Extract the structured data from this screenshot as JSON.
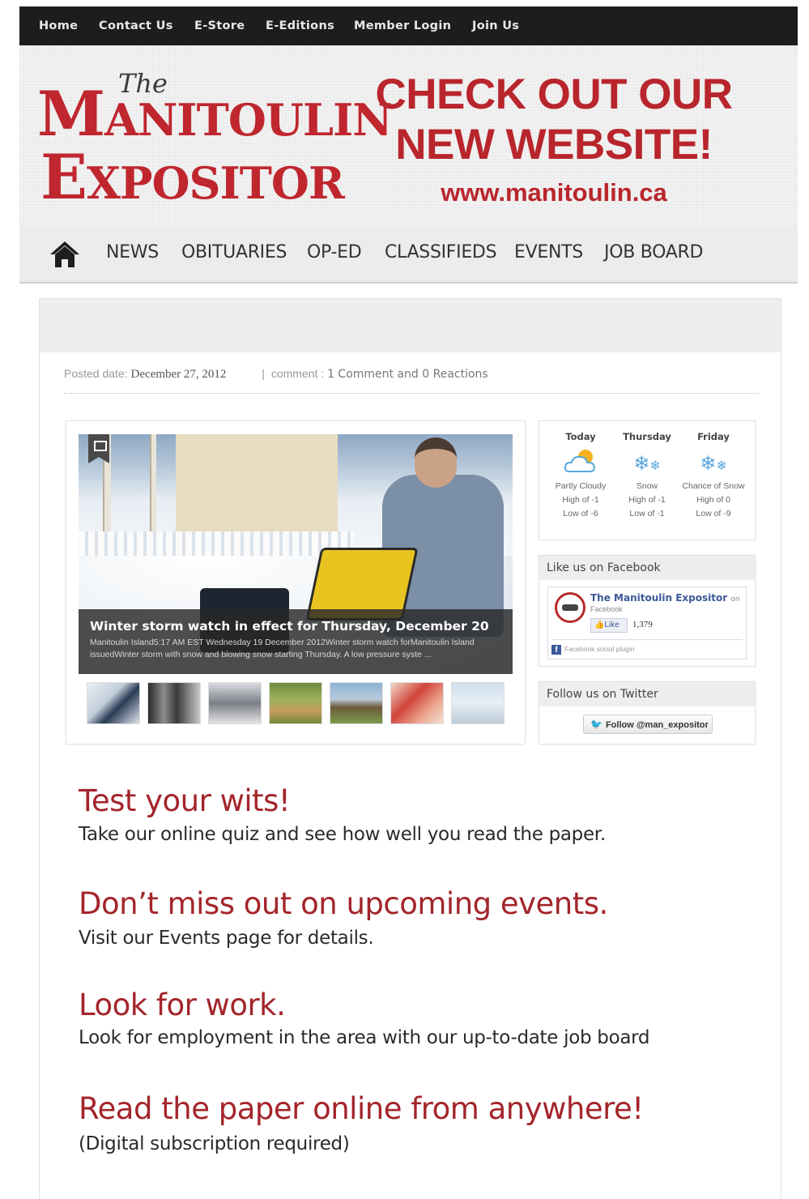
{
  "top_nav": [
    "Home",
    "Contact Us",
    "E-Store",
    "E-Editions",
    "Member Login",
    "Join Us"
  ],
  "logo": {
    "the": "The",
    "line1_cap": "M",
    "line1_rest": "ANITOULIN",
    "line2_cap": "E",
    "line2_rest": "XPOSITOR"
  },
  "promo_banner": {
    "line1": "CHECK OUT OUR",
    "line2": "NEW WEBSITE!",
    "url": "www.manitoulin.ca"
  },
  "main_nav": [
    "NEWS",
    "OBITUARIES",
    "OP-ED",
    "CLASSIFIEDS",
    "EVENTS",
    "JOB BOARD"
  ],
  "post_meta": {
    "date_label": "Posted date:",
    "date": "December 27, 2012",
    "separator": "|",
    "comment_label": "comment :",
    "comment_text": "1 Comment and 0 Reactions"
  },
  "slider": {
    "title": "Winter storm watch in effect for Thursday, December 20",
    "text": "Manitoulin Island5:17 AM EST Wednesday 19 December 2012Winter storm watch forManitoulin Island issuedWinter storm with snow and blowing snow starting Thursday. A low pressure syste ..."
  },
  "weather": [
    {
      "day": "Today",
      "condition": "Partly Cloudy",
      "high": "High of -1",
      "low": "Low of -6",
      "icon": "partly-cloudy-icon"
    },
    {
      "day": "Thursday",
      "condition": "Snow",
      "high": "High of -1",
      "low": "Low of -1",
      "icon": "snow-icon"
    },
    {
      "day": "Friday",
      "condition": "Chance of Snow",
      "high": "High of 0",
      "low": "Low of -9",
      "icon": "snow-icon"
    }
  ],
  "facebook": {
    "heading": "Like us on Facebook",
    "page_name": "The Manitoulin Expositor",
    "on": "on",
    "sub": "Facebook",
    "like_label": "Like",
    "like_count": "1,379",
    "plugin_label": "Facebook social plugin"
  },
  "twitter": {
    "heading": "Follow us on Twitter",
    "button": "Follow @man_expositor"
  },
  "promos": [
    {
      "heading": "Test your wits!",
      "text": "Take our online quiz and see how well you read the paper."
    },
    {
      "heading": "Don’t miss out on upcoming events.",
      "text": "Visit our Events page for details."
    },
    {
      "heading": "Look for work.",
      "text": "Look for employment in the area with our up-to-date job board"
    },
    {
      "heading": "Read the paper online from anywhere!",
      "text": "(Digital subscription required)"
    }
  ],
  "colors": {
    "brand_red": "#c0262e",
    "promo_heading_red": "#a3252b",
    "top_bar": "#1d1d1d"
  }
}
